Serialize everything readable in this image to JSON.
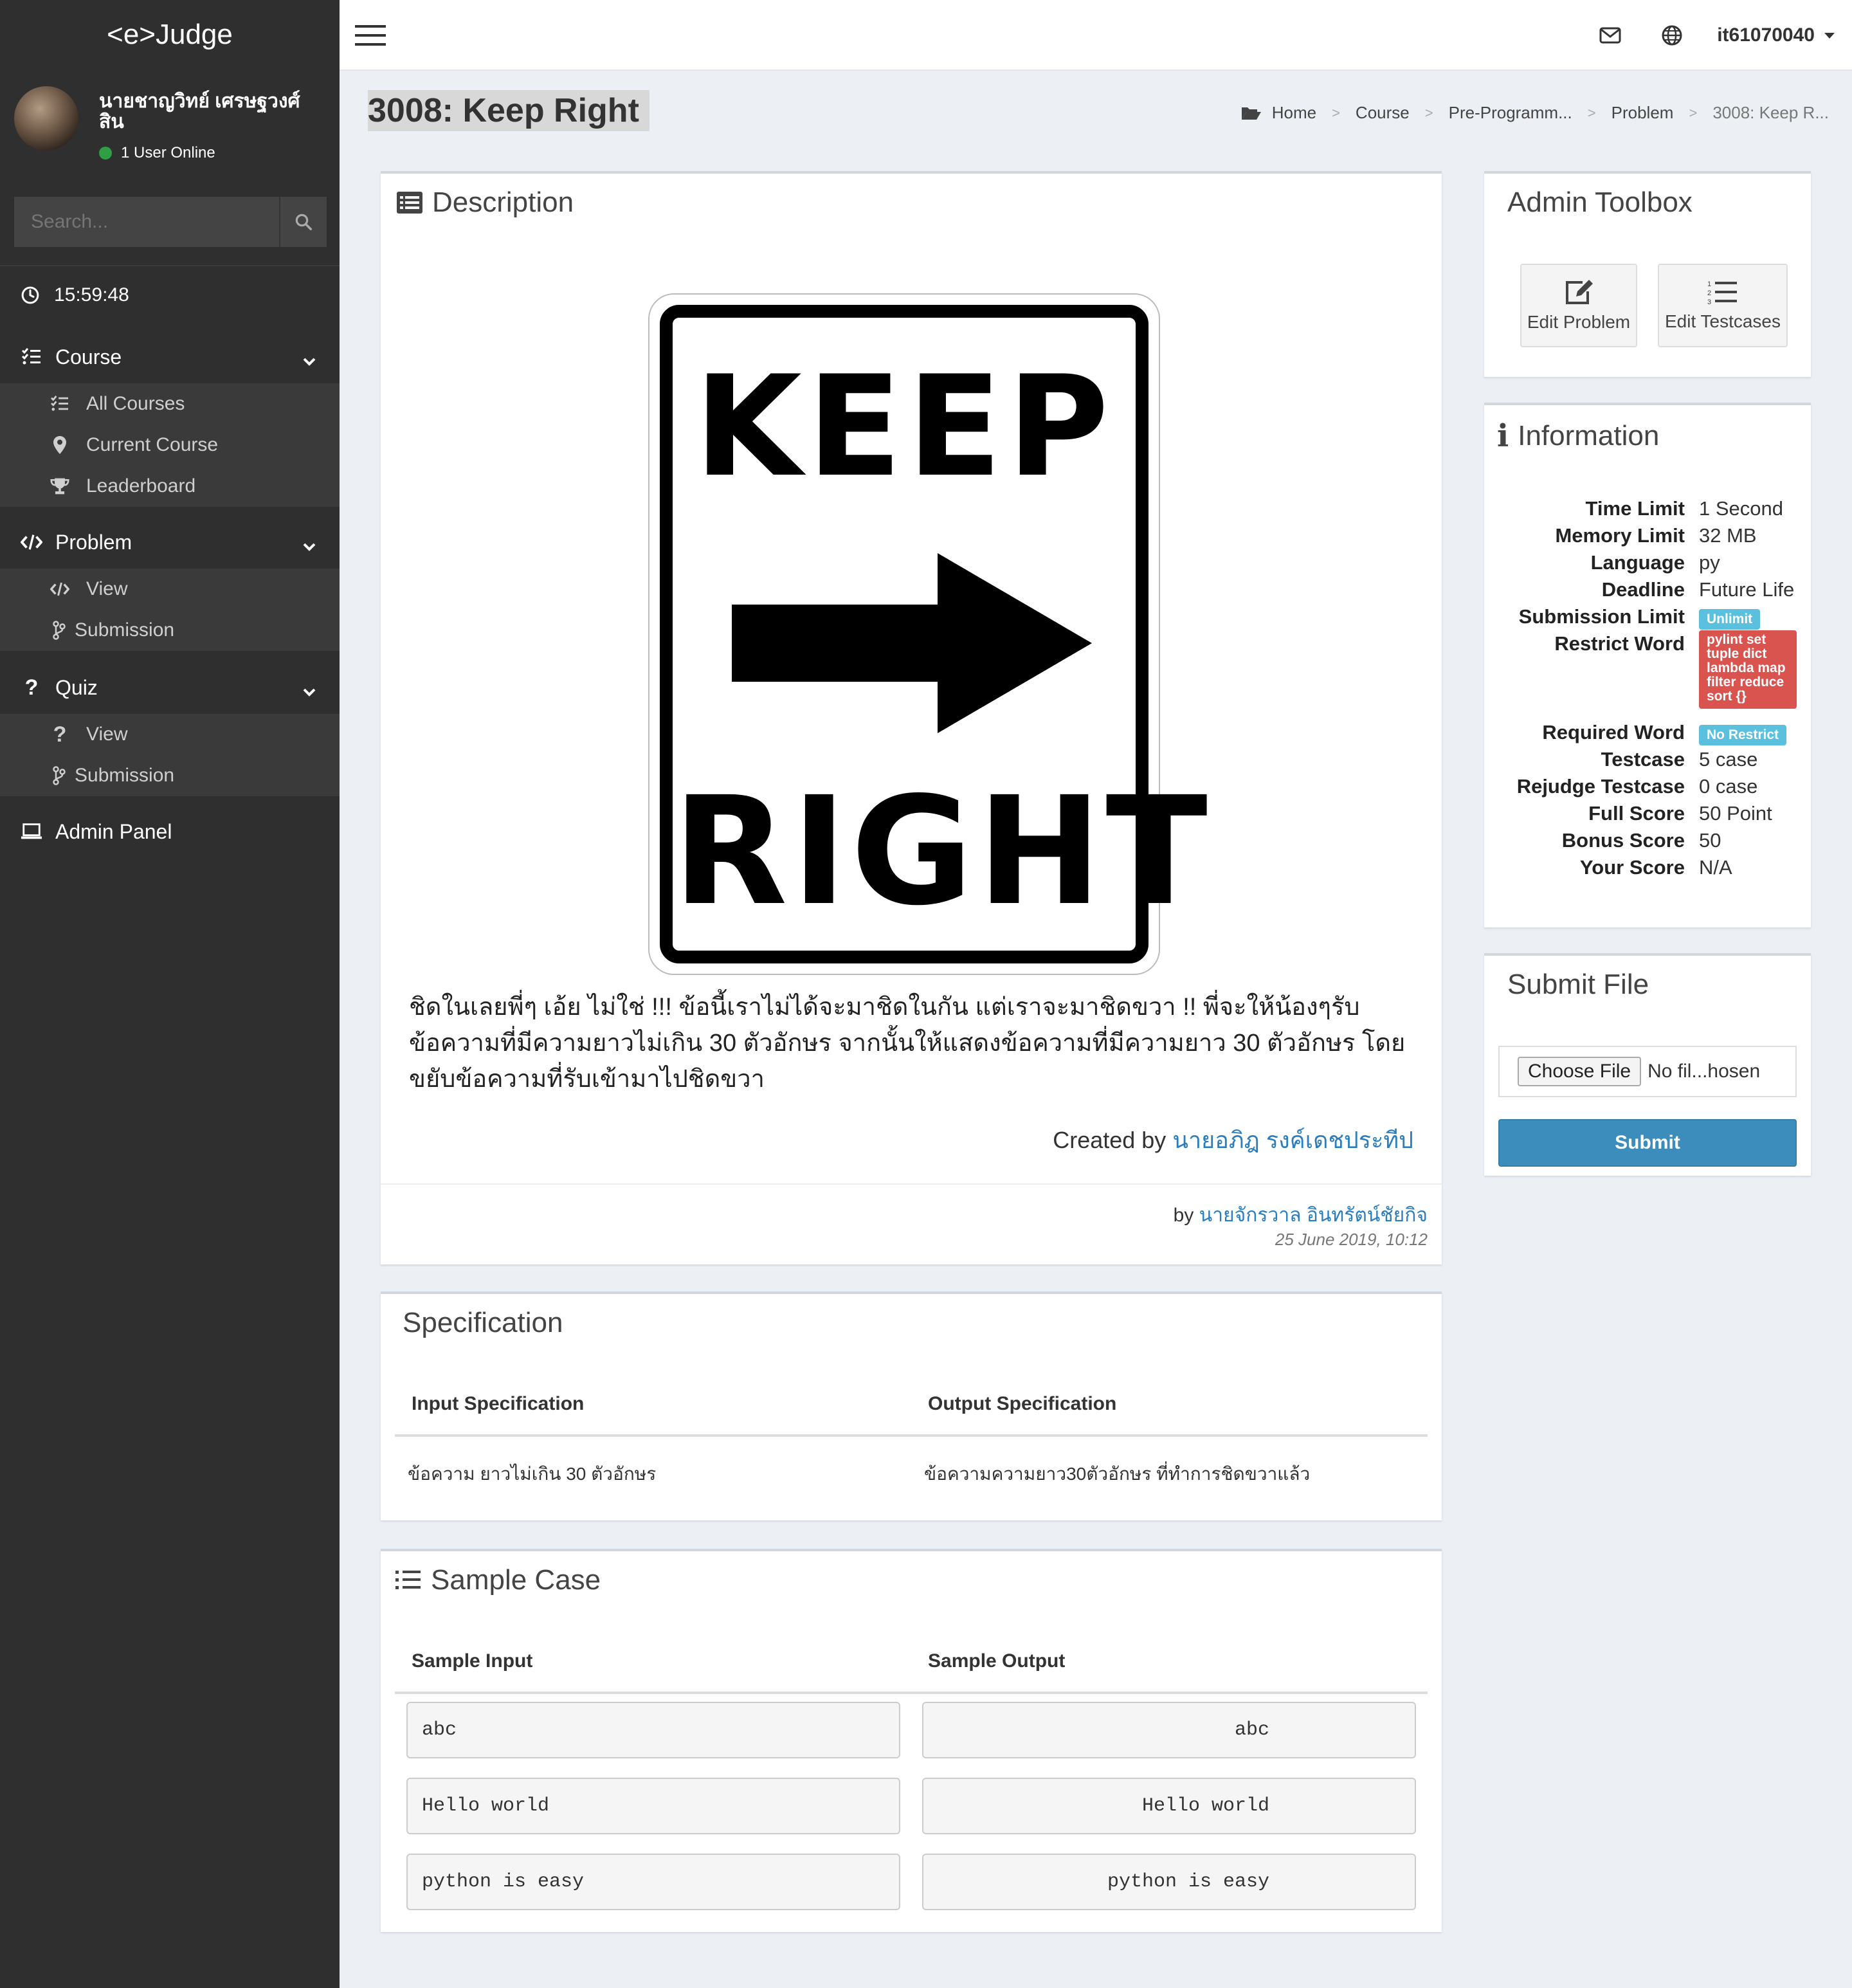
{
  "sidebar": {
    "brand": "<e>Judge",
    "user_name": "นายชาญวิทย์ เศรษฐวงศ์สิน",
    "online_text": "1 User Online",
    "search_placeholder": "Search...",
    "clock": "15:59:48",
    "sections": [
      {
        "label": "Course",
        "icon": "list-check-icon",
        "items": [
          {
            "label": "All Courses",
            "icon": "list-check-icon"
          },
          {
            "label": "Current Course",
            "icon": "map-marker-icon"
          },
          {
            "label": "Leaderboard",
            "icon": "trophy-icon"
          }
        ]
      },
      {
        "label": "Problem",
        "icon": "code-icon",
        "items": [
          {
            "label": "View",
            "icon": "code-icon"
          },
          {
            "label": "Submission",
            "icon": "code-branch-icon"
          }
        ]
      },
      {
        "label": "Quiz",
        "icon": "question-icon",
        "items": [
          {
            "label": "View",
            "icon": "question-icon"
          },
          {
            "label": "Submission",
            "icon": "code-branch-icon"
          }
        ]
      }
    ],
    "admin_panel": "Admin Panel"
  },
  "topbar": {
    "username": "it61070040"
  },
  "page": {
    "title": "3008: Keep Right",
    "breadcrumb": [
      "Home",
      "Course",
      "Pre-Programm...",
      "Problem",
      "3008: Keep R..."
    ]
  },
  "description": {
    "title": "Description",
    "sign_top": "KEEP",
    "sign_bottom": "RIGHT",
    "text": "ชิดในเลยพี่ๆ เอ้ย ไม่ใช่ !!! ข้อนี้เราไม่ได้จะมาชิดในกัน แต่เราจะมาชิดขวา !! พี่จะให้น้องๆรับข้อความที่มีความยาวไม่เกิน 30 ตัวอักษร จากนั้นให้แสดงข้อความที่มีความยาว 30 ตัวอักษร โดยขยับข้อความที่รับเข้ามาไปชิดขวา",
    "created_by_label": "Created by",
    "created_by_name": "นายอภิฎ รงค์เดชประทีป",
    "by_label": "by",
    "by_name": "นายจักรวาล อินทรัตน์ชัยกิจ",
    "date": "25 June 2019, 10:12"
  },
  "specification": {
    "title": "Specification",
    "input_header": "Input Specification",
    "output_header": "Output Specification",
    "input_text": "ข้อความ ยาวไม่เกิน 30 ตัวอักษร",
    "output_text": "ข้อความความยาว30ตัวอักษร ที่ทำการชิดขวาแล้ว"
  },
  "sample_case": {
    "title": "Sample Case",
    "input_header": "Sample Input",
    "output_header": "Sample Output",
    "rows": [
      {
        "input": "abc",
        "output": "abc"
      },
      {
        "input": "Hello world",
        "output": "Hello world"
      },
      {
        "input": "python is easy",
        "output": "python is easy"
      }
    ]
  },
  "admin_toolbox": {
    "title": "Admin Toolbox",
    "edit_problem": "Edit Problem",
    "edit_testcases": "Edit Testcases"
  },
  "information": {
    "title": "Information",
    "rows": [
      {
        "key": "Time Limit",
        "value": "1 Second"
      },
      {
        "key": "Memory Limit",
        "value": "32 MB"
      },
      {
        "key": "Language",
        "value": "py"
      },
      {
        "key": "Deadline",
        "value": "Future Life"
      },
      {
        "key": "Submission Limit",
        "value": "Unlimit"
      },
      {
        "key": "Restrict Word",
        "value": "pylint set tuple dict lambda map filter reduce sort {}"
      },
      {
        "key": "Required Word",
        "value": "No Restrict"
      },
      {
        "key": "Testcase",
        "value": "5 case"
      },
      {
        "key": "Rejudge Testcase",
        "value": "0 case"
      },
      {
        "key": "Full Score",
        "value": "50 Point"
      },
      {
        "key": "Bonus Score",
        "value": "50"
      },
      {
        "key": "Your Score",
        "value": "N/A"
      }
    ]
  },
  "submit_file": {
    "title": "Submit File",
    "choose_label": "Choose File",
    "file_status": "No fil...hosen",
    "submit_label": "Submit"
  },
  "colors": {
    "sidebar_bg": "#2f2f2f",
    "accent": "#3c8dbc",
    "link": "#2a7ec0",
    "badge_info": "#5bc0de",
    "badge_danger": "#d9534f"
  }
}
